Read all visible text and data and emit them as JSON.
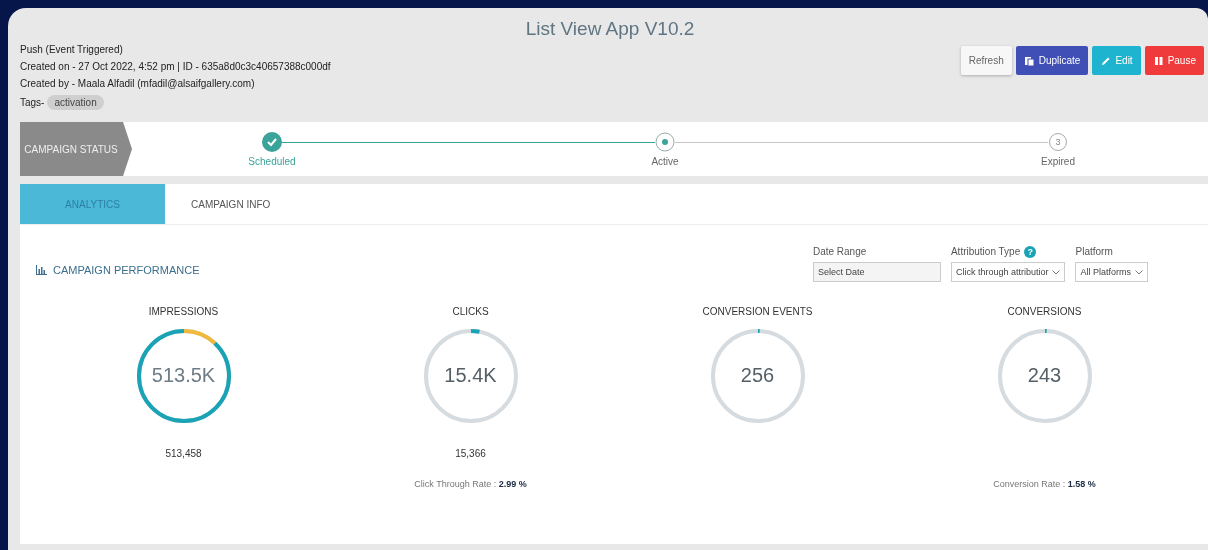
{
  "window": {
    "title": "List View App V10.2"
  },
  "details": [
    "Push (Event Triggered)",
    "Created on - 27 Oct 2022, 4:52 pm | ID - 635a8d0c3c40657388c000df",
    "Created by - Maala Alfadil (mfadil@alsaifgallery.com)"
  ],
  "tags": {
    "label": "Tags-",
    "items": [
      "activation"
    ]
  },
  "buttons": [
    {
      "label": "Refresh",
      "kind": "plain"
    },
    {
      "label": "Duplicate",
      "kind": "duplicate"
    },
    {
      "label": "Edit",
      "kind": "edit"
    },
    {
      "label": "Pause",
      "kind": "pause"
    }
  ],
  "campaign_status": {
    "label": "CAMPAIGN STATUS",
    "steps": [
      {
        "label": "Scheduled",
        "kind": "done"
      },
      {
        "label": "Active",
        "kind": "current"
      },
      {
        "label": "Expired",
        "kind": "pending",
        "number": "3"
      }
    ]
  },
  "tabs": [
    {
      "label": "ANALYTICS",
      "selected": true
    },
    {
      "label": "CAMPAIGN INFO",
      "selected": false
    }
  ],
  "performance": {
    "title": "CAMPAIGN PERFORMANCE",
    "filters": [
      {
        "label": "Date Range",
        "kind": "input",
        "placeholder": "Select Date"
      },
      {
        "label": "Attribution Type",
        "kind": "select",
        "value": "Click through attributior",
        "help": "?"
      },
      {
        "label": "Platform",
        "kind": "select",
        "value": "All Platforms"
      }
    ]
  },
  "metrics": [
    {
      "title": "IMPRESSIONS",
      "value": "513.5K",
      "kind": "split",
      "level": 0.88,
      "total": "513,458"
    },
    {
      "title": "CLICKS",
      "value": "15.4K",
      "kind": "plain",
      "level": 0.03,
      "total": "15,366",
      "rate_label": "Click Through Rate :",
      "rate": "2.99 %"
    },
    {
      "title": "CONVERSION EVENTS",
      "value": "256",
      "kind": "plain",
      "level": 0.006
    },
    {
      "title": "CONVERSIONS",
      "value": "243",
      "kind": "plain",
      "level": 0.006,
      "rate_label": "Conversion Rate :",
      "rate": "1.58 %"
    }
  ]
}
